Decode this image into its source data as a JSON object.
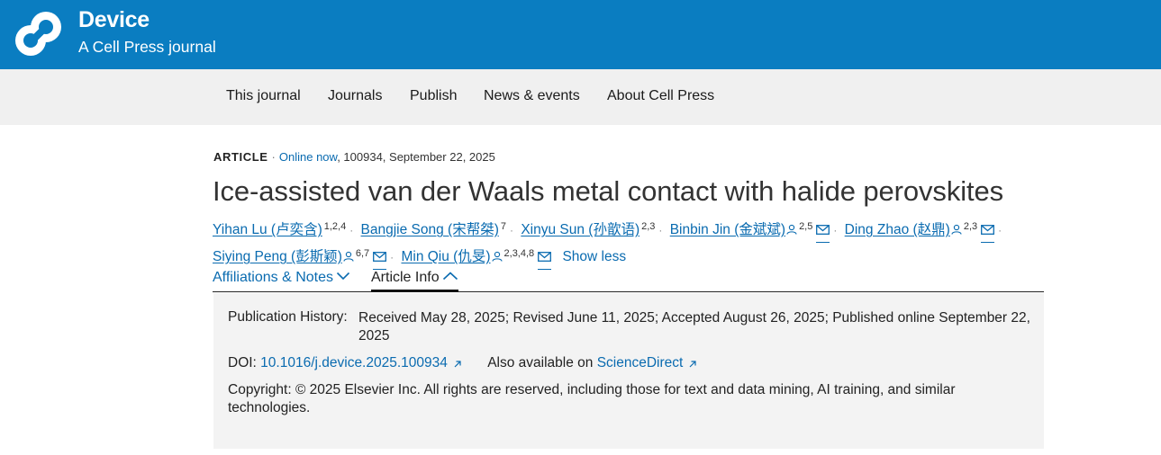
{
  "header": {
    "brand_title": "Device",
    "brand_subtitle": "A Cell Press journal",
    "brand_color": "#0a7dc1"
  },
  "nav": {
    "items": [
      "This journal",
      "Journals",
      "Publish",
      "News & events",
      "About Cell Press"
    ]
  },
  "article": {
    "type": "ARTICLE",
    "status": "Online now",
    "id_date": ", 100934, September 22, 2025",
    "title": "Ice-assisted van der Waals metal contact with halide perovskites",
    "authors": [
      {
        "name": "Yihan Lu (卢奕含)",
        "affiliations": "1,2,4"
      },
      {
        "name": "Bangjie Song (宋帮桀)",
        "affiliations": "7"
      },
      {
        "name": "Xinyu Sun (孙歆语)",
        "affiliations": "2,3"
      },
      {
        "name": "Binbin Jin (金斌斌)",
        "affiliations": "2,5"
      },
      {
        "name": "Ding Zhao (赵鼎)",
        "affiliations": "2,3"
      },
      {
        "name": "Siying Peng (彭斯颖)",
        "affiliations": "6,7"
      },
      {
        "name": "Min Qiu (仇旻)",
        "affiliations": "2,3,4,8"
      }
    ],
    "show_less": "Show less"
  },
  "tabs": {
    "affiliations": "Affiliations & Notes",
    "article_info": "Article Info"
  },
  "info": {
    "history_label": "Publication History:",
    "history_value": "Received May 28, 2025; Revised June 11, 2025; Accepted August 26, 2025; Published online September 22, 2025",
    "doi_label": "DOI: ",
    "doi_value": "10.1016/j.device.2025.100934",
    "also_label": "Also available on ",
    "also_link": "ScienceDirect",
    "copyright": "Copyright: © 2025 Elsevier Inc. All rights are reserved, including those for text and data mining, AI training, and similar technologies."
  }
}
